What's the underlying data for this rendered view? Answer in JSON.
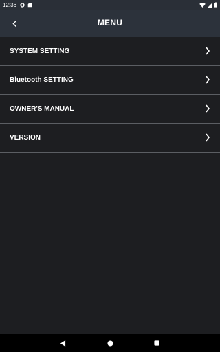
{
  "status_bar": {
    "time": "12:36"
  },
  "header": {
    "title": "MENU"
  },
  "menu": {
    "items": [
      {
        "label": "SYSTEM SETTING"
      },
      {
        "label": "Bluetooth SETTING"
      },
      {
        "label": "OWNER'S MANUAL"
      },
      {
        "label": "VERSION"
      }
    ]
  },
  "colors": {
    "background": "#1d1e21",
    "header": "#2c323b",
    "divider": "#5b5e63",
    "text": "#ffffff"
  }
}
